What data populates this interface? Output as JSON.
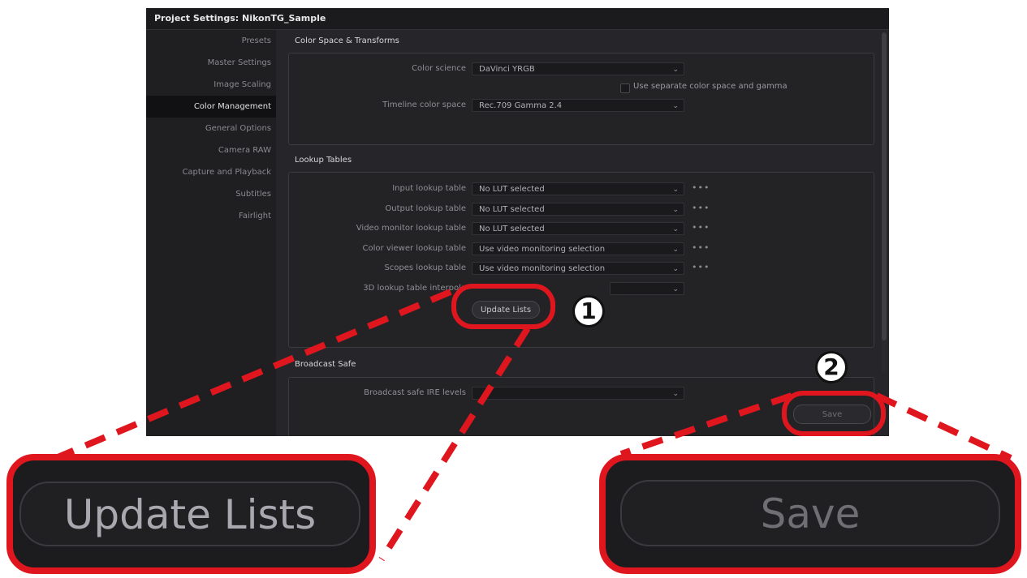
{
  "window": {
    "title": "Project Settings:  NikonTG_Sample"
  },
  "sidebar": {
    "items": [
      {
        "label": "Presets"
      },
      {
        "label": "Master Settings"
      },
      {
        "label": "Image Scaling"
      },
      {
        "label": "Color Management",
        "active": true
      },
      {
        "label": "General Options"
      },
      {
        "label": "Camera RAW"
      },
      {
        "label": "Capture and Playback"
      },
      {
        "label": "Subtitles"
      },
      {
        "label": "Fairlight"
      }
    ]
  },
  "color_space": {
    "title": "Color Space & Transforms",
    "color_science_label": "Color science",
    "color_science_value": "DaVinci YRGB",
    "separate_label": "Use separate color space and gamma",
    "timeline_label": "Timeline color space",
    "timeline_value": "Rec.709 Gamma 2.4"
  },
  "lookup": {
    "title": "Lookup Tables",
    "rows": [
      {
        "label": "Input lookup table",
        "value": "No LUT selected"
      },
      {
        "label": "Output lookup table",
        "value": "No LUT selected"
      },
      {
        "label": "Video monitor lookup table",
        "value": "No LUT selected"
      },
      {
        "label": "Color viewer lookup table",
        "value": "Use video monitoring selection"
      },
      {
        "label": "Scopes lookup table",
        "value": "Use video monitoring selection"
      }
    ],
    "interp_label": "3D lookup table interpola",
    "update_button": "Update Lists"
  },
  "broadcast": {
    "title": "Broadcast Safe",
    "row_label": "Broadcast safe IRE levels"
  },
  "footer": {
    "save_button": "Save"
  },
  "callouts": {
    "one": "1",
    "two": "2"
  },
  "zoom": {
    "update_lists": "Update Lists",
    "save": "Save"
  },
  "colors": {
    "highlight": "#e0161f",
    "window_bg": "#26262a",
    "sidebar_active": "#111113"
  }
}
